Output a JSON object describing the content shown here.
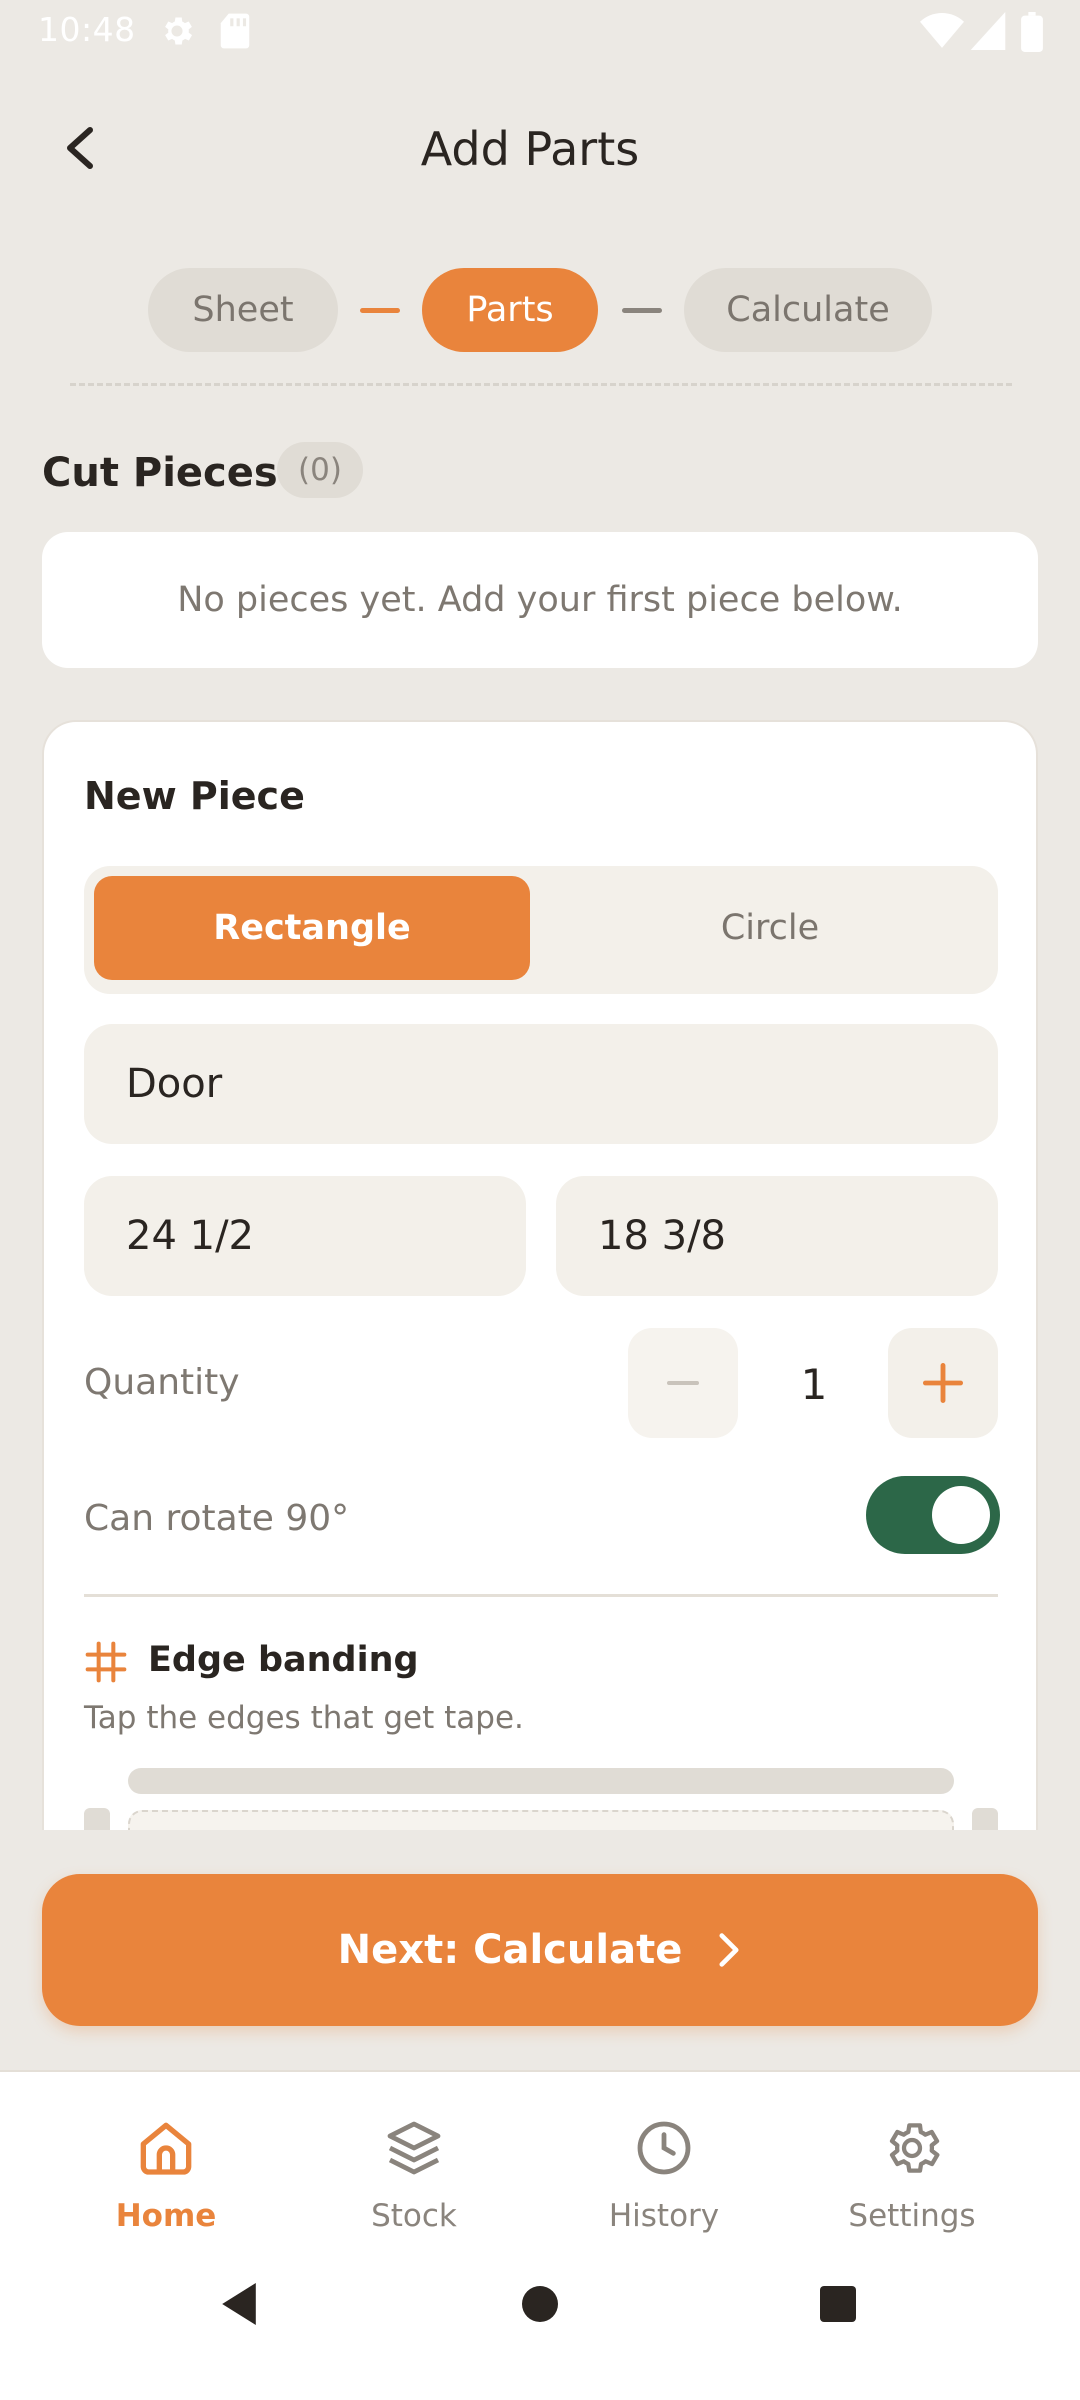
{
  "status_bar": {
    "time": "10:48"
  },
  "header": {
    "title": "Add Parts"
  },
  "stepper": {
    "steps": [
      {
        "label": "Sheet"
      },
      {
        "label": "Parts"
      },
      {
        "label": "Calculate"
      }
    ]
  },
  "cut_pieces": {
    "title": "Cut Pieces",
    "count": "(0)",
    "empty_message": "No pieces yet. Add your first piece below."
  },
  "new_piece": {
    "title": "New Piece",
    "shape_options": [
      "Rectangle",
      "Circle"
    ],
    "selected_shape": "Rectangle",
    "name_value": "Door",
    "width_value": "24 1/2",
    "height_value": "18 3/8",
    "quantity_label": "Quantity",
    "quantity_value": "1",
    "rotate_label": "Can rotate 90°",
    "rotate_enabled": true,
    "edge_banding_title": "Edge banding",
    "edge_banding_hint": "Tap the edges that get tape."
  },
  "next_button": {
    "label": "Next: Calculate"
  },
  "bottom_nav": {
    "items": [
      {
        "label": "Home",
        "icon": "home-icon",
        "active": true
      },
      {
        "label": "Stock",
        "icon": "layers-icon",
        "active": false
      },
      {
        "label": "History",
        "icon": "clock-icon",
        "active": false
      },
      {
        "label": "Settings",
        "icon": "gear-icon",
        "active": false
      }
    ]
  },
  "colors": {
    "accent": "#E9843C",
    "background": "#ECE9E4",
    "toggle_on": "#2C6748"
  }
}
